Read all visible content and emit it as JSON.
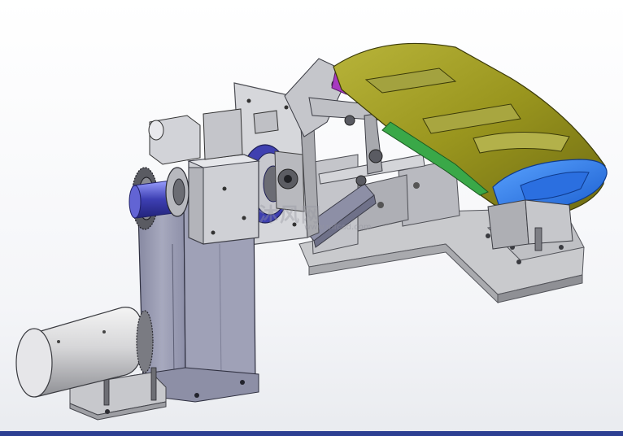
{
  "watermark": {
    "text": "沐风网",
    "url": "www.mfcad.com"
  },
  "colors": {
    "background": "#f3f4f7",
    "base_plate": "#c9cacd",
    "column_steel": "#9b9db3",
    "yellow_part": "#9a9620",
    "blue_part": "#2e7be6",
    "purple_bracket": "#a73ac0",
    "gear_blue": "#3f40b0",
    "accent_band": "#2d3f92"
  }
}
